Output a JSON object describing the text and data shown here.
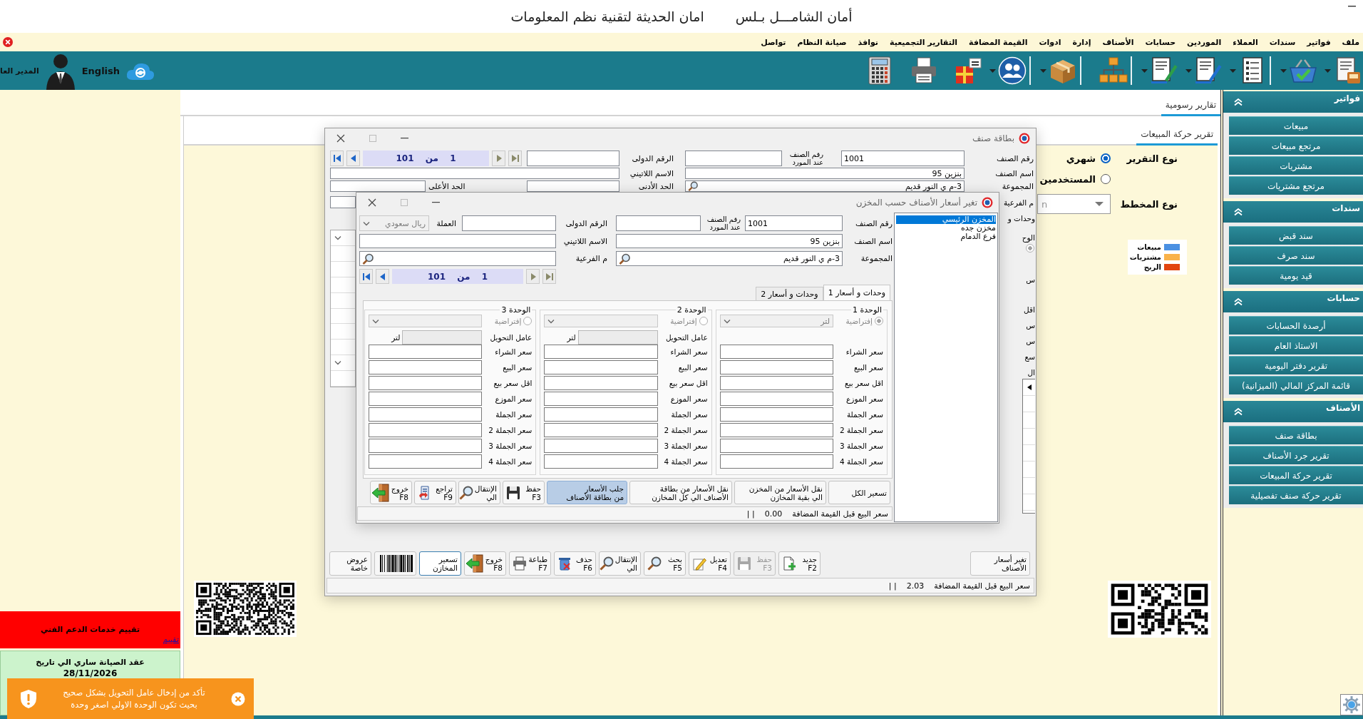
{
  "window": {
    "title": "أمان الشامـــل بـلس",
    "subtitle": "امان الحديثة لتقنية نظم المعلومات"
  },
  "menu_bar": {
    "items": [
      "ملف",
      "فواتير",
      "سندات",
      "العملاء",
      "الموردين",
      "حسابات",
      "الأصناف",
      "إدارة",
      "ادوات",
      "القيمة المضافة",
      "التقارير التجميعية",
      "نوافذ",
      "صيانة النظام",
      "تواصل"
    ]
  },
  "toolbar": {
    "buttons": [
      {
        "has_menu": true
      },
      {
        "has_menu": true
      },
      {
        "has_menu": true
      },
      {
        "has_menu": true
      },
      {
        "has_menu": true
      },
      {
        "has_menu": false
      },
      {
        "has_menu": true
      },
      {
        "has_menu": true
      },
      {
        "has_menu": false
      },
      {
        "has_menu": false
      },
      {
        "has_menu": false
      }
    ],
    "language": "English",
    "user": "المدير العا"
  },
  "left_panel": {
    "rating": {
      "title": "تقييم خدمات الدعم الفني",
      "link": "تقييم"
    },
    "contract": {
      "text": "عقد الصيانة ساري الي تاريخ",
      "date": "28/11/2026"
    }
  },
  "reports": {
    "tabs": [
      {
        "label": "تقارير رسومية",
        "selected": true
      }
    ],
    "report_tabs": [
      {
        "label": "تقرير حركة المبيعات",
        "selected": true
      }
    ],
    "report_type": {
      "label": "نوع التقرير",
      "options": [
        {
          "label": "شهري",
          "selected": true
        },
        {
          "label": "المستخدمين",
          "selected": false
        }
      ]
    },
    "chart_type": {
      "label": "نوع المخطط",
      "value": "n"
    },
    "legend": [
      {
        "label": "مبيعات",
        "color": "#4a90e2"
      },
      {
        "label": "مشتريات",
        "color": "#f9b24a"
      },
      {
        "label": "الربح",
        "color": "#e2450f"
      }
    ]
  },
  "sidebar": {
    "sections": [
      {
        "title": "فواتير",
        "expanded": true,
        "items": [
          "مبيعات",
          "مرتجع مبيعات",
          "مشتريات",
          "مرتجع مشتريات"
        ]
      },
      {
        "title": "سندات",
        "expanded": true,
        "items": [
          "سند قبض",
          "سند صرف",
          "قيد يومية"
        ]
      },
      {
        "title": "حسابات",
        "expanded": true,
        "items": [
          "أرصدة الحسابات",
          "الاستاذ العام",
          "تقرير دفتر اليومية",
          "قائمة المركز المالي (الميزانية)"
        ]
      },
      {
        "title": "الأصناف",
        "expanded": true,
        "items": [
          "بطاقة صنف",
          "تقرير جرد الأصناف",
          "تقرير حركة المبيعات",
          "تقرير حركة صنف تفصيلية"
        ]
      }
    ]
  },
  "item_card": {
    "title": "بطاقة صنف",
    "item_no": {
      "label": "رقم الصنف",
      "value": "1001"
    },
    "supplier_no": {
      "label_lines": [
        "رقم الصنف",
        "عند المورد"
      ]
    },
    "intl_no": {
      "label": "الرقم الدولى"
    },
    "counter": "1 من 101",
    "name": {
      "label": "اسم الصنف",
      "value": "بنزين 95"
    },
    "latin_name": {
      "label": "الاسم اللاتيني"
    },
    "group": {
      "label": "المجموعة",
      "value": "3-م ي النور قديم"
    },
    "min": {
      "label": "الحد الأدنى"
    },
    "max": {
      "label": "الحد الأعلى"
    },
    "subgroup": {
      "label": "م الفرعية"
    },
    "covered_fragments": [
      "وحدات و",
      "الوح",
      "س",
      "اقل",
      "س",
      "س",
      "سع",
      "ال"
    ],
    "covered_radio": {
      "checked": true,
      "disabled": true
    },
    "buttons": [
      {
        "kind": "text",
        "lines": [
          "تغير أسعار",
          "الأصناف"
        ],
        "focused": false,
        "disabled": false
      },
      {
        "kind": "text",
        "lines": [
          "جديد",
          "F2"
        ],
        "focused": false,
        "disabled": false
      },
      {
        "kind": "text",
        "lines": [
          "حفظ",
          "F3"
        ],
        "focused": false,
        "disabled": true
      },
      {
        "kind": "text",
        "lines": [
          "تعديل",
          "F4"
        ],
        "focused": false,
        "disabled": false
      },
      {
        "kind": "text",
        "lines": [
          "بحث",
          "F5"
        ],
        "focused": false,
        "disabled": false
      },
      {
        "kind": "text",
        "lines": [
          "الإنتقال",
          "الي"
        ],
        "focused": false,
        "disabled": false
      },
      {
        "kind": "text",
        "lines": [
          "حذف",
          "F6"
        ],
        "focused": false,
        "disabled": false
      },
      {
        "kind": "text",
        "lines": [
          "طباعة",
          "F7"
        ],
        "focused": false,
        "disabled": false
      },
      {
        "kind": "text",
        "lines": [
          "خروج",
          "F8"
        ],
        "focused": false,
        "disabled": false
      },
      {
        "kind": "text",
        "lines": [
          "تسعير",
          "المخازن"
        ],
        "focused": true,
        "disabled": false
      },
      {
        "kind": "icon",
        "focused": false,
        "disabled": false
      },
      {
        "kind": "text",
        "lines": [
          "عروض",
          "خاصة"
        ],
        "focused": false,
        "disabled": false
      }
    ],
    "status": {
      "label": "سعر البيع قبل القيمة المضافة",
      "value": "2.03",
      "separator": "| |"
    }
  },
  "price_dialog": {
    "title": "تغير أسعار الأصناف حسب المخزن",
    "item_no": {
      "label": "رقم الصنف",
      "value": "1001"
    },
    "supplier_no": {
      "label_lines": [
        "رقم الصنف",
        "عند المورد"
      ]
    },
    "intl_no": {
      "label": "الرقم الدولى"
    },
    "currency": {
      "label": "العملة",
      "value": "ريال سعودي",
      "disabled": true
    },
    "name": {
      "label": "اسم الصنف",
      "value": "بنزين 95"
    },
    "latin_name": {
      "label": "الاسم اللاتيني"
    },
    "group": {
      "label": "المجموعة",
      "value": "3-م ي النور قديم"
    },
    "subgroup": {
      "label": "م الفرعية"
    },
    "counter": "1 من 101",
    "warehouses": [
      {
        "name": "المخزن الرئيسي",
        "selected": true
      },
      {
        "name": "مخزن جده",
        "selected": false
      },
      {
        "name": "فرع الدمام",
        "selected": false
      }
    ],
    "tabs": [
      {
        "label": "وحدات و أسعار 1",
        "selected": true
      },
      {
        "label": "وحدات و أسعار 2",
        "selected": false
      }
    ],
    "units": [
      {
        "title": "الوحدة 1",
        "default_label": "إفتراضية",
        "default": true,
        "disabled": true,
        "unit": "لتر",
        "prices": [
          "سعر الشراء",
          "سعر البيع",
          "اقل سعر بيع",
          "سعر الموزع",
          "سعر الجملة",
          "سعر الجملة 2",
          "سعر الجملة 3",
          "سعر الجملة 4"
        ]
      },
      {
        "title": "الوحدة 2",
        "default_label": "إفتراضية",
        "default": false,
        "disabled": true,
        "conversion": {
          "label": "عامل التحويل",
          "unit": "لتر"
        },
        "prices": [
          "سعر الشراء",
          "سعر البيع",
          "اقل سعر بيع",
          "سعر الموزع",
          "سعر الجملة",
          "سعر الجملة 2",
          "سعر الجملة 3",
          "سعر الجملة 4"
        ]
      },
      {
        "title": "الوحدة 3",
        "default_label": "إفتراضية",
        "default": false,
        "disabled": true,
        "conversion": {
          "label": "عامل التحويل",
          "unit": "لتر"
        },
        "prices": [
          "سعر الشراء",
          "سعر البيع",
          "اقل سعر بيع",
          "سعر الموزع",
          "سعر الجملة",
          "سعر الجملة 2",
          "سعر الجملة 3",
          "سعر الجملة 4"
        ]
      }
    ],
    "buttons": [
      {
        "lines": [
          "تسعير الكل"
        ],
        "focused": false
      },
      {
        "lines": [
          "نقل الأسعار من المخزن",
          "الي بقية المخازن"
        ],
        "focused": false
      },
      {
        "lines": [
          "نقل الأسعار من بطاقة",
          "الأصناف الي كل المخازن"
        ],
        "focused": false
      },
      {
        "lines": [
          "جلب الأسعار",
          "من بطاقة الأصناف"
        ],
        "focused": true
      },
      {
        "lines": [
          "حفظ",
          "F3"
        ],
        "focused": false
      },
      {
        "lines": [
          "الإنتقال",
          "الي"
        ],
        "focused": false
      },
      {
        "lines": [
          "تراجع",
          "F9"
        ],
        "focused": false
      },
      {
        "lines": [
          "خروج",
          "F8"
        ],
        "focused": false
      }
    ],
    "status": {
      "label": "سعر البيع قبل القيمة المضافة",
      "value": "0.00",
      "separator": "| |"
    }
  },
  "toast": {
    "lines": [
      "تأكد من إدخال عامل التحويل بشكل صحيح",
      "بحيث تكون الوحدة الاولي اصغر وحدة"
    ]
  }
}
